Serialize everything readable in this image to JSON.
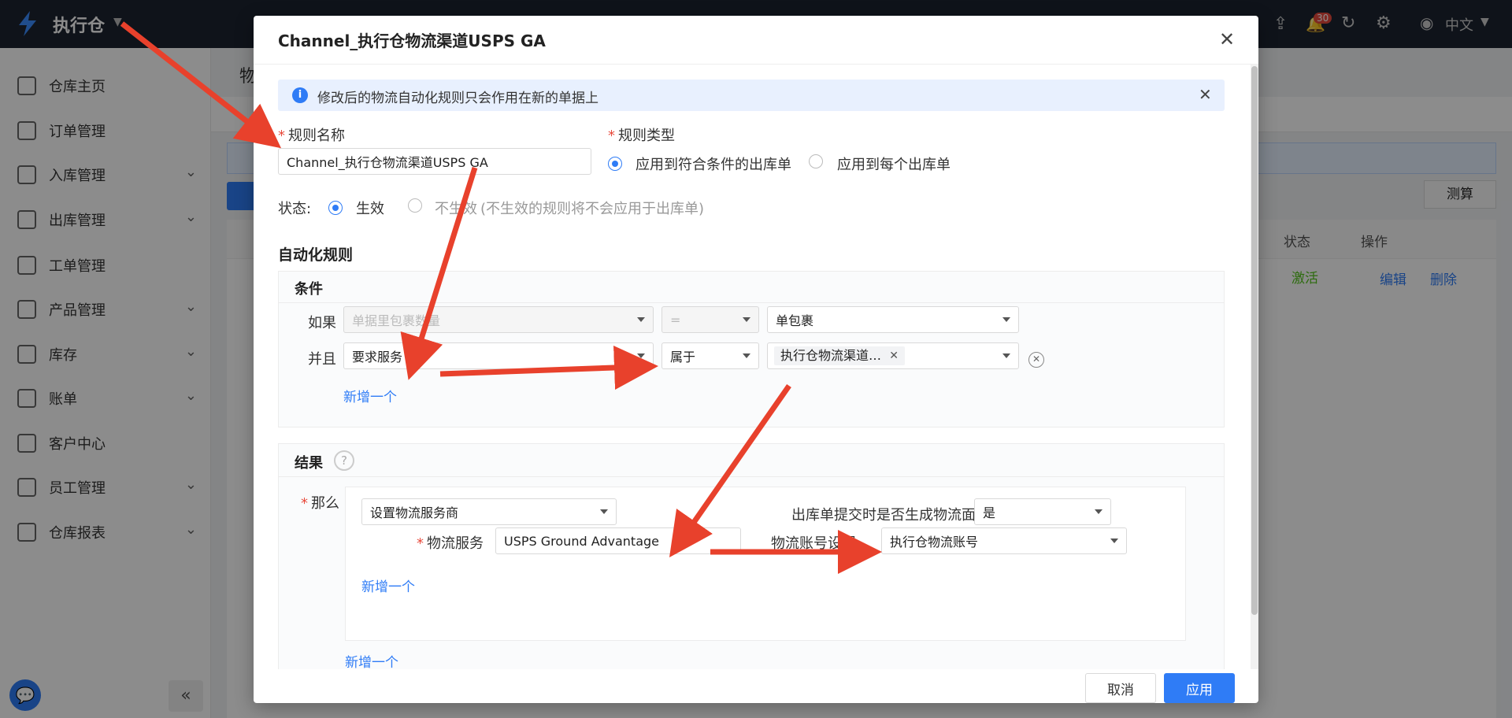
{
  "app": {
    "name": "执行仓",
    "lang": "中文",
    "notif_count": "30"
  },
  "sidebar": {
    "items": [
      {
        "label": "仓库主页",
        "icon": "home-icon"
      },
      {
        "label": "订单管理",
        "icon": "cart-icon"
      },
      {
        "label": "入库管理",
        "icon": "truck-in-icon"
      },
      {
        "label": "出库管理",
        "icon": "truck-out-icon"
      },
      {
        "label": "工单管理",
        "icon": "clipboard-icon"
      },
      {
        "label": "产品管理",
        "icon": "tag-icon"
      },
      {
        "label": "库存",
        "icon": "warehouse-icon"
      },
      {
        "label": "账单",
        "icon": "card-icon"
      },
      {
        "label": "客户中心",
        "icon": "user-icon"
      },
      {
        "label": "员工管理",
        "icon": "badge-icon"
      },
      {
        "label": "仓库报表",
        "icon": "report-icon"
      }
    ]
  },
  "background": {
    "page_title_fragment": "物",
    "btn_measure": "测算",
    "col_status": "状态",
    "col_ops": "操作",
    "row_status": "激活",
    "row_edit": "编辑",
    "row_delete": "删除"
  },
  "modal": {
    "title": "Channel_执行仓物流渠道USPS GA",
    "info_banner": "修改后的物流自动化规则只会作用在新的单据上",
    "rule_name_label": "规则名称",
    "rule_name_value": "Channel_执行仓物流渠道USPS GA",
    "rule_type_label": "规则类型",
    "rule_type_options": [
      "应用到符合条件的出库单",
      "应用到每个出库单"
    ],
    "status_label": "状态:",
    "status_on": "生效",
    "status_off": "不生效",
    "status_off_hint": "(不生效的规则将不会应用于出库单)",
    "auto_rules_title": "自动化规则",
    "conditions_title": "条件",
    "cond_if": "如果",
    "cond_if_field": "单据里包裹数量",
    "cond_if_op": "=",
    "cond_if_value": "单包裹",
    "cond_and": "并且",
    "cond_and_field": "要求服务",
    "cond_and_op": "属于",
    "cond_and_tag": "执行仓物流渠道…",
    "add_one": "新增一个",
    "results_title": "结果",
    "then_label": "那么",
    "then_action": "设置物流服务商",
    "gen_label_q": "出库单提交时是否生成物流面单?",
    "gen_label_value": "是",
    "service_label": "物流服务",
    "service_value": "USPS Ground Advantage",
    "account_label": "物流账号设置",
    "account_value": "执行仓物流账号",
    "add_one_inner": "新增一个",
    "add_one_outer": "新增一个",
    "cancel": "取消",
    "apply": "应用"
  },
  "colors": {
    "primary": "#2f7cf6",
    "arrow": "#e8412c",
    "topbar": "#1c2330"
  }
}
